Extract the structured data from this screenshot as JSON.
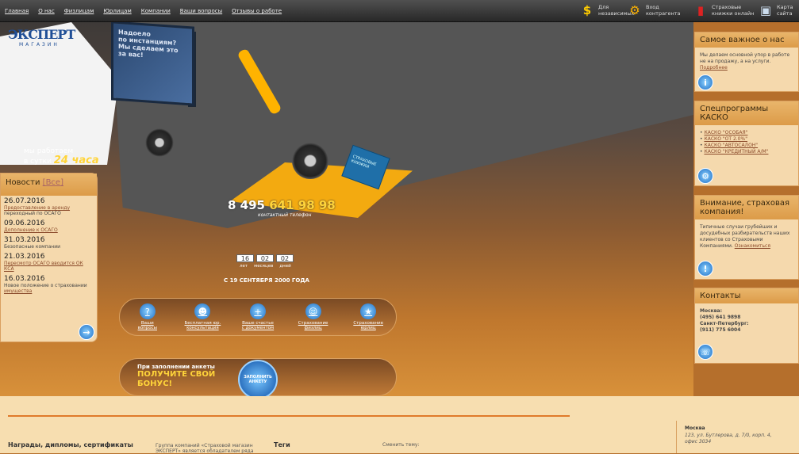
{
  "nav": [
    "Главная",
    "О нас",
    "Физлицам",
    "Юрлицам",
    "Компании",
    "Ваши вопросы",
    "Отзывы о работе"
  ],
  "quick": [
    {
      "icon": "dollar-icon",
      "label": "Для\nнезависимых"
    },
    {
      "icon": "car-icon",
      "label": "Вход\nконтрагента"
    },
    {
      "icon": "book-icon",
      "label": "Страховые\nкнижки онлайн"
    },
    {
      "icon": "map-icon",
      "label": "Карта\nсайта"
    }
  ],
  "logo": {
    "title": "ЭКСПЕРТ",
    "subtitle": "МАГАЗИН"
  },
  "billboard": "Надоело\nпо инстанциям?\nМы сделаем это\nза вас!",
  "work": {
    "line1": "мы работаем",
    "line2": "в сутки",
    "hours": "24 часа"
  },
  "book_label": "СТРАХОВЫЕ КНИЖКИ",
  "phone": {
    "prefix": "8 495",
    "number": "641 98 98",
    "sub": "контактный телефон"
  },
  "counter": {
    "values": [
      "16",
      "02",
      "02"
    ],
    "labels": [
      "лет",
      "месяцев",
      "дней"
    ]
  },
  "since": "С 19 СЕНТЯБРЯ 2000 ГОДА",
  "actions": [
    {
      "icon": "question-icon",
      "label": "Ваши\nвопросы"
    },
    {
      "icon": "person-icon",
      "label": "Бесплатная юр.\nконсультация"
    },
    {
      "icon": "plus-icon",
      "label": "Ваше счастье\nс документом"
    },
    {
      "icon": "person-icon",
      "label": "Страхование\nфизлиц"
    },
    {
      "icon": "people-icon",
      "label": "Страхование\nюрлиц"
    }
  ],
  "bonus": {
    "line1": "При заполнении анкеты",
    "line2": "ПОЛУЧИТЕ СВОЙ",
    "line3": "БОНУС!",
    "button": "ЗАПОЛНИТЬ\nАНКЕТУ"
  },
  "news": {
    "title": "Новости",
    "all": "[Все]",
    "items": [
      {
        "date": "26.07.2016",
        "text": "Предоставление в аренду",
        "link": "переходный по ОСАГО"
      },
      {
        "date": "09.06.2016",
        "text": "",
        "link": "Дополнение к ОСАГО"
      },
      {
        "date": "31.03.2016",
        "text": "Безопасные",
        "link": "компании"
      },
      {
        "date": "21.03.2016",
        "text": "",
        "link": "Пересмотр ОСАГО вводится ОК КСА"
      },
      {
        "date": "16.03.2016",
        "text": "Новое положение о страховании",
        "link": "имущества"
      }
    ],
    "more_icon": "arrow-icon"
  },
  "side": [
    {
      "title": "Самое важное о нас",
      "text": "Мы делаем основной упор в работе не на продажу, а на услуги.",
      "link": "Подробнее",
      "icon": "info-icon"
    },
    {
      "title": "Спецпрограммы КАСКО",
      "list": [
        "КАСКО \"ОСОБАЯ\"",
        "КАСКО \"ОТ 2.0%\"",
        "КАСКО \"АВТОСАЛОН\"",
        "КАСКО \"КРЕДИТНЫЙ А/М\""
      ],
      "icon": "wheel-icon"
    },
    {
      "title": "Внимание, страховая компания!",
      "text": "Типичные случаи грубейших и досудебных разбирательств наших клиентов со Страховыми Компаниями.",
      "link": "Ознакомиться",
      "icon": "warning-icon"
    },
    {
      "title": "Контакты",
      "text": "Москва:\n(495) 641 9898\nСанкт-Петербург:\n(911) 775 6004",
      "icon": "phone-icon"
    }
  ],
  "footer": {
    "awards": "Награды, дипломы, сертификаты",
    "group": "Группа компаний «Страховой магазин ЭКСПЕРТ» является обладателем ряда",
    "tags": "Теги",
    "choose": "Сменить тему:",
    "city": "Москва",
    "address": "123, ул. Бутлерова, д. 7/0, корп. 4,",
    "office": "офис 3034"
  }
}
